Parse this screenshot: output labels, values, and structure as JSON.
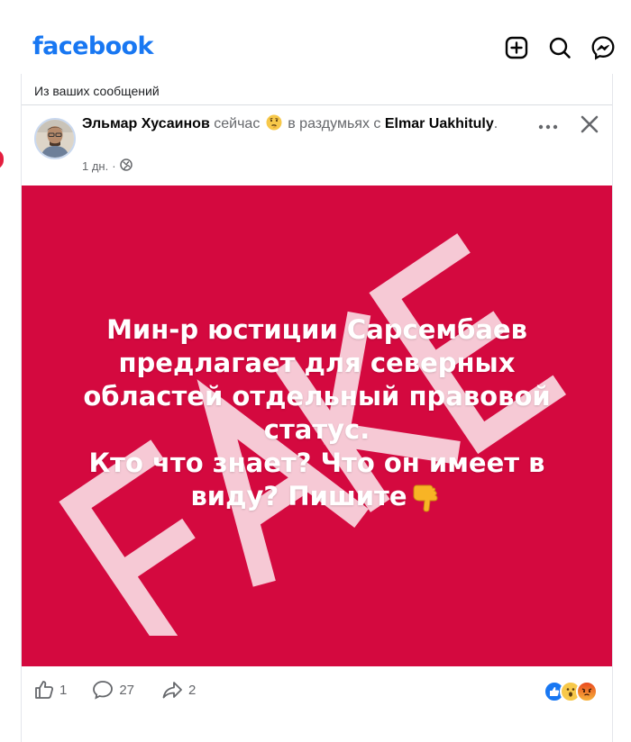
{
  "app": {
    "logo_text": "facebook",
    "brand_color": "#1877f2"
  },
  "toolbar": {
    "icons": [
      "add-icon",
      "search-icon",
      "messenger-icon"
    ]
  },
  "post": {
    "source_label": "Из ваших сообщений",
    "author": "Эльмар Хусаинов",
    "time_inline": "сейчас",
    "feeling_text": "в раздумьях с",
    "tagged_user": "Elmar Uakhituly",
    "timestamp": "1 дн.",
    "audience_icon": "globe-icon",
    "image": {
      "background_color": "#d4093f",
      "stamp_text": "FAKE",
      "lines": [
        "Мин-р юстиции Сарсембаев",
        "предлагает для северных",
        "областей отдельный правовой",
        "статус.",
        "Кто что знает? Что он имеет в",
        "виду? Пишите"
      ]
    },
    "counts": {
      "likes": "1",
      "comments": "27",
      "shares": "2"
    },
    "reactions": [
      "like-reaction-icon",
      "wow-reaction-icon",
      "angry-reaction-icon"
    ]
  }
}
